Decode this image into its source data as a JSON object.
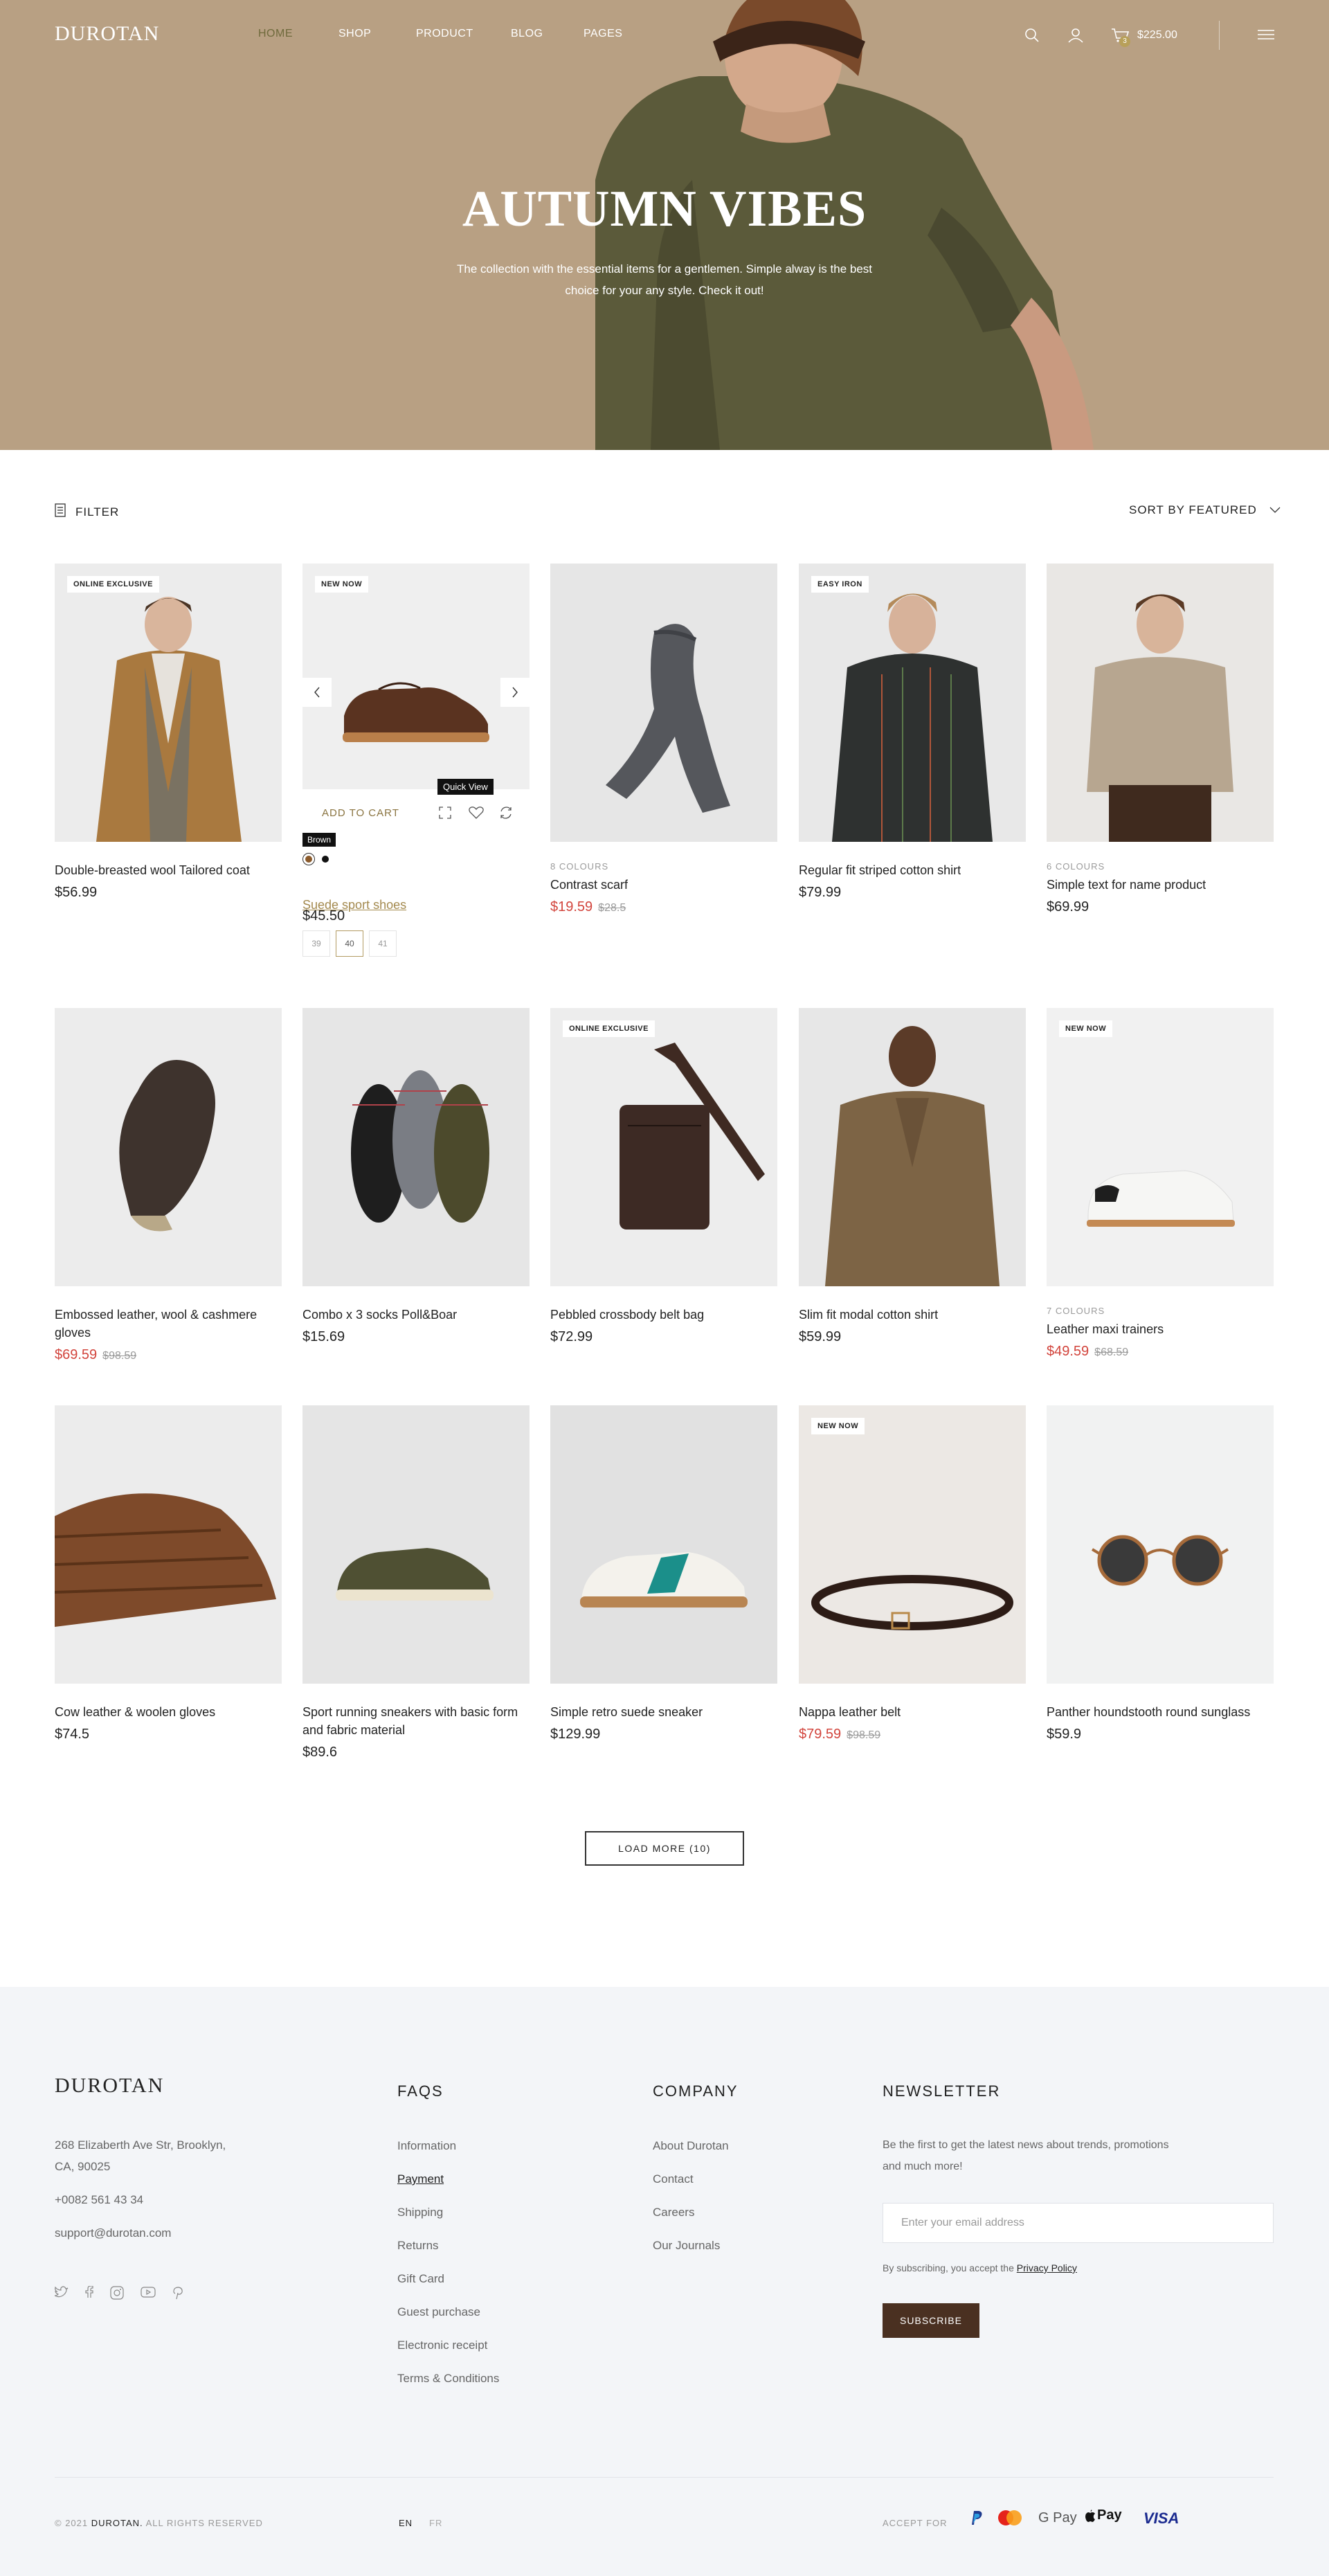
{
  "brand": {
    "logo": "DUROTAN"
  },
  "nav": {
    "items": [
      {
        "label": "HOME",
        "active": true
      },
      {
        "label": "SHOP",
        "active": false
      },
      {
        "label": "PRODUCT",
        "active": false
      },
      {
        "label": "BLOG",
        "active": false
      },
      {
        "label": "PAGES",
        "active": false
      }
    ],
    "cart_total": "$225.00",
    "cart_count": "3",
    "icons": [
      "search-icon",
      "user-icon",
      "cart-icon",
      "menu-icon"
    ]
  },
  "hero": {
    "title": "AUTUMN VIBES",
    "subtitle": "The collection with the essential items for a gentlemen. Simple alway is the best choice for your any style. Check it out!"
  },
  "toolbar": {
    "filter_label": "FILTER",
    "sort_label": "SORT BY FEATURED"
  },
  "products": [
    {
      "name": "Double-breasted wool Tailored coat",
      "price": "$56.99",
      "badge": "ONLINE EXCLUSIVE"
    },
    {
      "name": "Suede sport shoes",
      "price": "$45.50",
      "badge": "NEW NOW",
      "add_to_cart": "ADD TO CART",
      "quick_view": "Quick View",
      "swatch_tip": "Brown",
      "sizes": [
        "39",
        "40",
        "41"
      ],
      "selected_size": "40"
    },
    {
      "name": "Contrast scarf",
      "colours": "8 COLOURS",
      "price": "$19.59",
      "old_price": "$28.5",
      "sale": true
    },
    {
      "name": "Regular fit striped cotton shirt",
      "price": "$79.99",
      "badge": "EASY IRON"
    },
    {
      "name": "Simple text for name product",
      "colours": "6 COLOURS",
      "price": "$69.99"
    },
    {
      "name": "Embossed leather, wool & cashmere gloves",
      "price": "$69.59",
      "old_price": "$98.59",
      "sale": true
    },
    {
      "name": "Combo x 3 socks Poll&Boar",
      "price": "$15.69"
    },
    {
      "name": "Pebbled crossbody belt bag",
      "price": "$72.99",
      "badge": "ONLINE EXCLUSIVE"
    },
    {
      "name": "Slim fit modal cotton shirt",
      "price": "$59.99"
    },
    {
      "name": "Leather maxi trainers",
      "colours": "7 COLOURS",
      "price": "$49.59",
      "old_price": "$68.59",
      "sale": true,
      "badge": "NEW NOW"
    },
    {
      "name": "Cow leather & woolen gloves",
      "price": "$74.5"
    },
    {
      "name": "Sport running sneakers with basic form and fabric material",
      "price": "$89.6"
    },
    {
      "name": "Simple retro suede sneaker",
      "price": "$129.99"
    },
    {
      "name": "Nappa leather belt",
      "price": "$79.59",
      "old_price": "$98.59",
      "sale": true,
      "badge": "NEW NOW"
    },
    {
      "name": "Panther houndstooth round sunglass",
      "price": "$59.9"
    }
  ],
  "load_more": "LOAD MORE (10)",
  "footer": {
    "logo": "DUROTAN",
    "address_line1": "268 Elizaberth Ave Str, Brooklyn,",
    "address_line2": "CA, 90025",
    "phone": "+0082 561 43 34",
    "email": "support@durotan.com",
    "faqs": {
      "title": "FAQS",
      "links": [
        "Information",
        "Payment",
        "Shipping",
        "Returns",
        "Gift Card",
        "Guest purchase",
        "Electronic receipt",
        "Terms & Conditions"
      ]
    },
    "company": {
      "title": "COMPANY",
      "links": [
        "About Durotan",
        "Contact",
        "Careers",
        "Our Journals"
      ]
    },
    "newsletter": {
      "title": "NEWSLETTER",
      "text_line1": "Be the first to get the latest news about trends, promotions",
      "text_line2": "and much more!",
      "placeholder": "Enter your email address",
      "consent": "By subscribing, you accept the",
      "privacy": "Privacy Policy",
      "button": "SUBSCRIBE"
    },
    "copyright_prefix": "© 2021",
    "copyright_brand": "DUROTAN.",
    "copyright_suffix": "ALL RIGHTS RESERVED",
    "lang_en": "EN",
    "lang_fr": "FR",
    "accept_for": "ACCEPT FOR",
    "payments": [
      "paypal-icon",
      "mastercard-icon",
      "G Pay",
      "Pay",
      "VISA"
    ]
  },
  "colors": {
    "hero_bg": "#b8a083",
    "accent": "#b39b63",
    "sale": "#d2443c",
    "subscribe_bg": "#4a3021",
    "footer_bg": "#f3f5f8"
  }
}
